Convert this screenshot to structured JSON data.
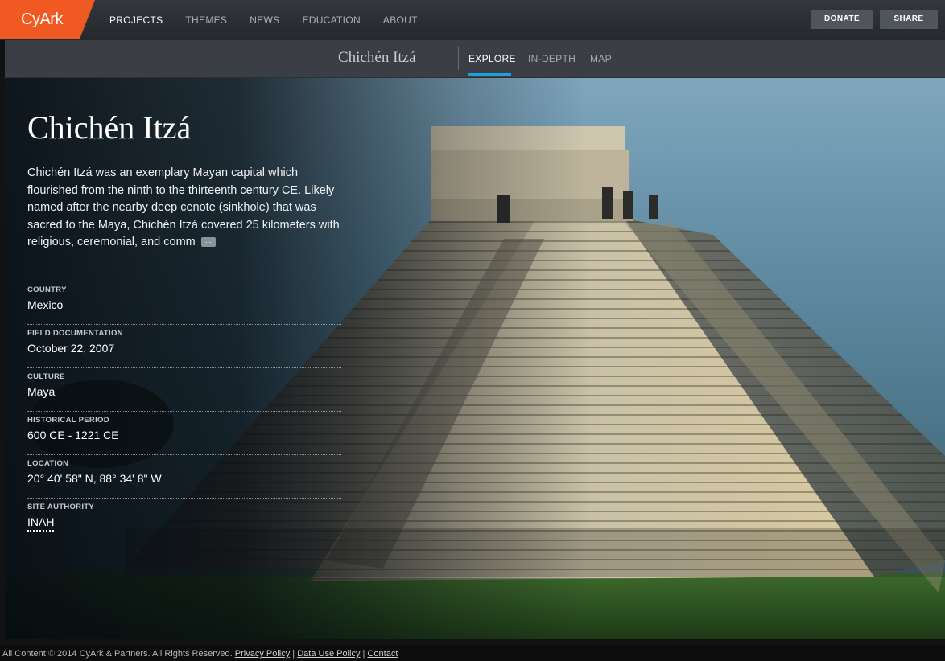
{
  "header": {
    "logo": "CyArk",
    "nav": [
      "PROJECTS",
      "THEMES",
      "NEWS",
      "EDUCATION",
      "ABOUT"
    ],
    "active_nav": "PROJECTS",
    "donate_label": "DONATE",
    "share_label": "SHARE",
    "brand_color": "#f05a22"
  },
  "subnav": {
    "site_title": "Chichén Itzá",
    "tabs": [
      "EXPLORE",
      "IN-DEPTH",
      "MAP"
    ],
    "active_tab": "EXPLORE",
    "accent_color": "#1ea0df"
  },
  "hero": {
    "title": "Chichén Itzá",
    "description": "Chichén Itzá was an exemplary Mayan capital which flourished from the ninth to the thirteenth century CE. Likely named after the nearby deep cenote (sinkhole) that was sacred to the Maya, Chichén Itzá covered 25 kilometers with religious, ceremonial, and comm",
    "more_label": "...",
    "facts": [
      {
        "label": "COUNTRY",
        "value": "Mexico"
      },
      {
        "label": "FIELD DOCUMENTATION",
        "value": "October 22, 2007"
      },
      {
        "label": "CULTURE",
        "value": "Maya"
      },
      {
        "label": "HISTORICAL PERIOD",
        "value": "600 CE - 1221 CE"
      },
      {
        "label": "LOCATION",
        "value": "20° 40' 58\" N, 88° 34' 8\" W"
      },
      {
        "label": "SITE AUTHORITY",
        "value": "INAH"
      }
    ]
  },
  "footer": {
    "prefix": "All Content",
    "copyright_symbol": "©",
    "text": "2014 CyArk & Partners. All Rights Reserved.",
    "links": [
      "Privacy Policy",
      "Data Use Policy",
      "Contact"
    ],
    "separator": "|"
  }
}
